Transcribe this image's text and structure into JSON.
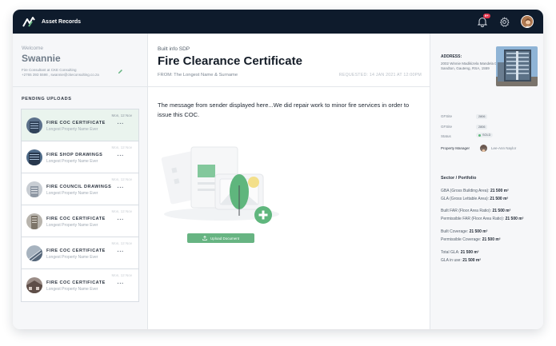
{
  "app": {
    "title": "Asset Records",
    "notification_count": "9+"
  },
  "user": {
    "welcome": "Welcome",
    "name": "Swannie",
    "company": "Fire Consultant at CKE Consulting",
    "contact": "+2765 393 5598 , swannie@ckeconsulting.co.za"
  },
  "pending": {
    "title": "PENDING UPLOADS",
    "items": [
      {
        "title": "FIRE COC CERTIFICATE",
        "sub": "Longest Property Name Ever",
        "date": "Mon, 12 Nov"
      },
      {
        "title": "FIRE SHOP DRAWINGS",
        "sub": "Longest Property Name Ever",
        "date": "Mon, 12 Nov"
      },
      {
        "title": "FIRE COUNCIL DRAWINGS",
        "sub": "Longest Property Name Ever",
        "date": "Mon, 12 Nov"
      },
      {
        "title": "FIRE COC CERTIFICATE",
        "sub": "Longest Property Name Ever",
        "date": "Mon, 12 Nov"
      },
      {
        "title": "FIRE COC CERTIFICATE",
        "sub": "Longest Property Name Ever",
        "date": "Mon, 12 Nov"
      },
      {
        "title": "FIRE COC CERTIFICATE",
        "sub": "Longest Property Name Ever",
        "date": "Mon, 12 Nov"
      }
    ],
    "dots": "···"
  },
  "document": {
    "subtitle": "Built info SDP",
    "title": "Fire Clearance Certificate",
    "from": "FROM: The Longest Name & Surname",
    "requested": "REQUESTED: 14 JAN 2021 AT 12:00PM",
    "message": "The message from sender displayed here...We did repair work to minor fire services in order to issue this COC.",
    "upload_label": "Upload Document"
  },
  "property": {
    "address_label": "ADDRESS:",
    "address": "2002 Winnie Madikizela Mandela Dr, Sandton, Gauteng, RSA, 1559",
    "fields": [
      {
        "label": "GFSite",
        "value": "2806"
      },
      {
        "label": "GFSite",
        "value": "2806"
      }
    ],
    "status_label": "Status",
    "status_value": "SOLD",
    "pm_label": "Property Manager",
    "pm_name": "Lee-Ann Naylor",
    "sector_title": "Sector / Portfolio",
    "metrics": [
      {
        "label": "GBA (Gross Building Area):",
        "value": "21 500 m²"
      },
      {
        "label": "GLA (Gross Lettable Area):",
        "value": "21 500 m²"
      },
      {
        "label": "Built FAR (Floor Area Ratio):",
        "value": "21 500 m²"
      },
      {
        "label": "Permissible FAR (Floor Area Ratio):",
        "value": "21 500 m²"
      },
      {
        "label": "Built Coverage:",
        "value": "21 500 m²"
      },
      {
        "label": "Permissible Coverage:",
        "value": "21 500 m²"
      },
      {
        "label": "Total GLA:",
        "value": "21 500 m²"
      },
      {
        "label": "GLA in use:",
        "value": "21 500 m²"
      }
    ]
  },
  "colors": {
    "topbar": "#0e1b2c",
    "accent_green": "#67b482",
    "badge_red": "#e2384f",
    "active_item": "#eaf4ee"
  },
  "icons": [
    "logo-icon",
    "bell-icon",
    "gear-icon",
    "pencil-icon",
    "upload-icon"
  ]
}
